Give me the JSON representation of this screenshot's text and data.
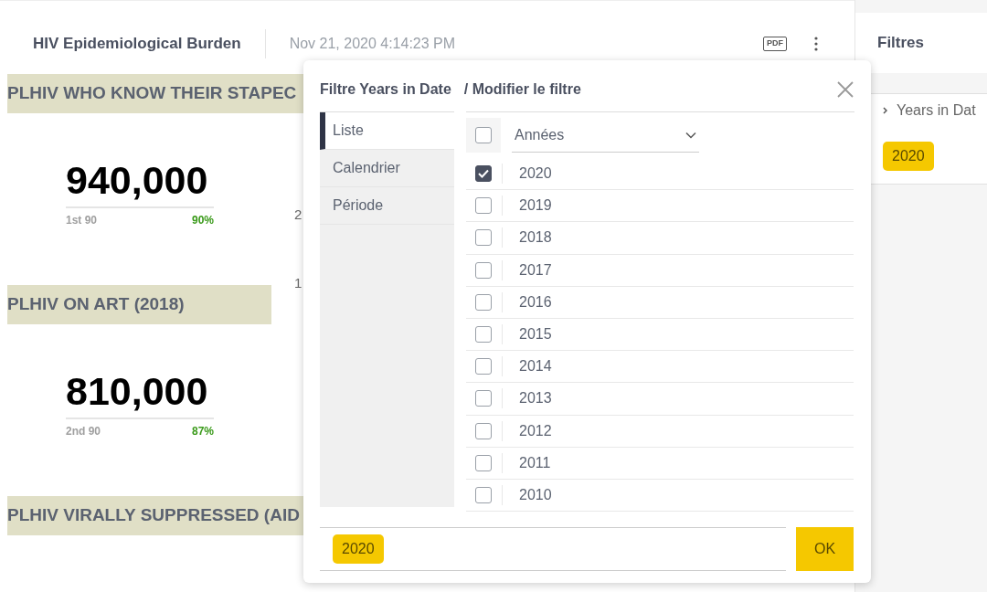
{
  "dashboard": {
    "title": "HIV Epidemiological Burden",
    "timestamp": "Nov 21, 2020 4:14:23 PM",
    "pdf_label": "PDF",
    "sections": [
      {
        "heading": "PLHIV WHO KNOW THEIR STAPEC",
        "value": "940,000",
        "label": "1st 90",
        "percent": "90%"
      },
      {
        "heading": "PLHIV ON ART (2018)",
        "value": "810,000",
        "label": "2nd 90",
        "percent": "87%"
      },
      {
        "heading": "PLHIV VIRALLY SUPPRESSED (AID"
      }
    ],
    "axis_fragments": [
      "2",
      "1"
    ]
  },
  "filters_panel": {
    "title": "Filtres",
    "filter_name": "Years in Dat",
    "chips": [
      "2020"
    ]
  },
  "modal": {
    "title": "Filtre Years in Date",
    "subtitle": "/ Modifier le filtre",
    "tabs": [
      {
        "label": "Liste",
        "selected": true
      },
      {
        "label": "Calendrier",
        "selected": false
      },
      {
        "label": "Période",
        "selected": false
      }
    ],
    "select_all_checked": false,
    "level_select": "Années",
    "options": [
      {
        "label": "2020",
        "checked": true
      },
      {
        "label": "2019",
        "checked": false
      },
      {
        "label": "2018",
        "checked": false
      },
      {
        "label": "2017",
        "checked": false
      },
      {
        "label": "2016",
        "checked": false
      },
      {
        "label": "2015",
        "checked": false
      },
      {
        "label": "2014",
        "checked": false
      },
      {
        "label": "2013",
        "checked": false
      },
      {
        "label": "2012",
        "checked": false
      },
      {
        "label": "2011",
        "checked": false
      },
      {
        "label": "2010",
        "checked": false
      }
    ],
    "selected_chips": [
      "2020"
    ],
    "ok_label": "OK"
  }
}
